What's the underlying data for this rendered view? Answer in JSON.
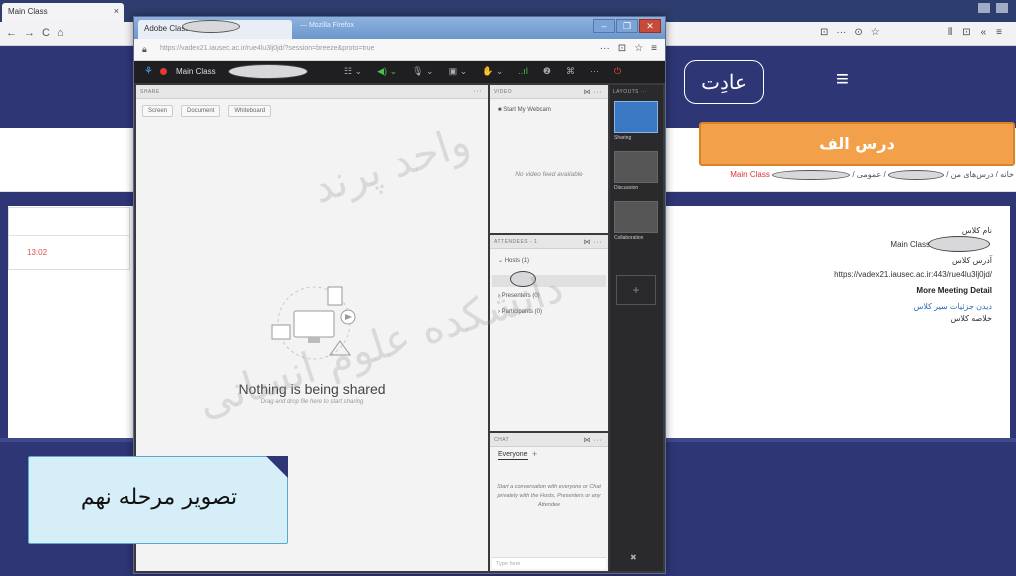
{
  "background_browser": {
    "tab_title": "Main Class",
    "tab_close": "×",
    "nav_icons": [
      "←",
      "→",
      "C",
      "⌂"
    ],
    "toolbar_right": [
      "⊡",
      "···",
      "⊙",
      "☆"
    ],
    "toolbar_far_right": [
      "⫴",
      "⊡",
      "«",
      "≡"
    ]
  },
  "lms": {
    "logo_text": "عادِت",
    "menu_icon": "≡",
    "course_badge": "درس الف",
    "breadcrumb": {
      "home": "خانه",
      "my_courses": "درس‌های من",
      "general": "عمومی",
      "current": "Main Class",
      "sep": "/"
    },
    "left_card_time": "13:02",
    "info": {
      "class_name_label": "نام کلاس",
      "class_name_value": "Main Class",
      "class_address_label": "آدرس کلاس",
      "class_address_value": "https://vadex21.iausec.ac.ir:443/rue4lu3lj0jd/",
      "more_details": "More Meeting Detail",
      "record_link": "دیدن جزئیات سیر کلاس",
      "summary_label": "خلاصه کلاس"
    }
  },
  "connect_window": {
    "tab_title": "Adobe Class",
    "title_extra": "— Mozilla Firefox",
    "window_controls": [
      "–",
      "❐",
      "✕"
    ],
    "url": "https://vadex21.iausec.ac.ir/rue4lu3lj0jd/?session=breeze&proto=true",
    "url_host": "vadex21.iausec.ac.ir",
    "url_tools": [
      "···",
      "⊡",
      "☆",
      "≡"
    ],
    "meeting_title": "Main Class",
    "toolbar_icons": [
      "☷ ⌄",
      "◀) ⌄",
      "🎙 ⌄",
      "▣ ⌄",
      "✋ ⌄",
      "..ıl",
      "❷",
      "⌘",
      "···",
      "⏻"
    ],
    "share_pod": {
      "header": "SHARE",
      "buttons": [
        "Screen",
        "Document",
        "Whiteboard"
      ],
      "message": "Nothing is being shared",
      "sub_message": "Drag and drop file here to start sharing"
    },
    "video_pod": {
      "header": "VIDEO",
      "start_webcam": "Start My Webcam",
      "no_video": "No video feed available"
    },
    "attendees_pod": {
      "header": "ATTENDEES - 1",
      "hosts": "Hosts (1)",
      "presenters": "Presenters (0)",
      "participants": "Participants (0)"
    },
    "chat_pod": {
      "header": "CHAT",
      "tab": "Everyone",
      "message": "Start a conversation with everyone or Chat privately with the Hosts, Presenters or any Attendee",
      "input_placeholder": "Type here"
    },
    "layouts": {
      "header": "LAYOUTS ···",
      "items": [
        "Sharing",
        "Discussion",
        "Collaboration"
      ],
      "add": "+",
      "tool_icon": "✖"
    }
  },
  "caption": {
    "text": "تصویر مرحله نهم"
  },
  "watermark": {
    "lines": [
      "واحد پرند",
      "دانشکده علوم انسانی"
    ]
  }
}
